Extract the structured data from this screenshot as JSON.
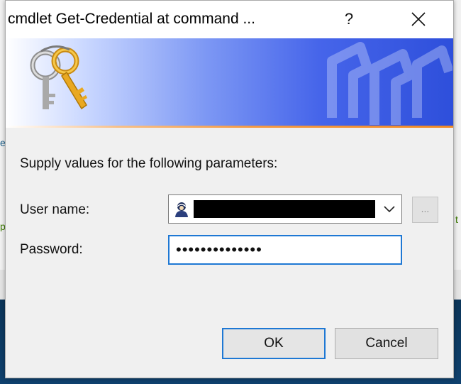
{
  "dialog": {
    "title": "cmdlet Get-Credential at command ...",
    "help_glyph": "?",
    "prompt": "Supply values for the following parameters:",
    "fields": {
      "user_label": "User name:",
      "user_value_redacted": true,
      "browse_label": "...",
      "password_label": "Password:",
      "password_mask": "••••••••••••••"
    },
    "buttons": {
      "ok": "OK",
      "cancel": "Cancel"
    }
  },
  "icons": {
    "banner": "keys-icon",
    "watermark": "keys-watermark-icon",
    "user": "user-icon",
    "dropdown": "chevron-down-icon",
    "close": "close-icon"
  },
  "colors": {
    "focus_blue": "#1e78d4",
    "banner_blue": "#2e4fdb",
    "banner_orange": "#f08a25"
  }
}
